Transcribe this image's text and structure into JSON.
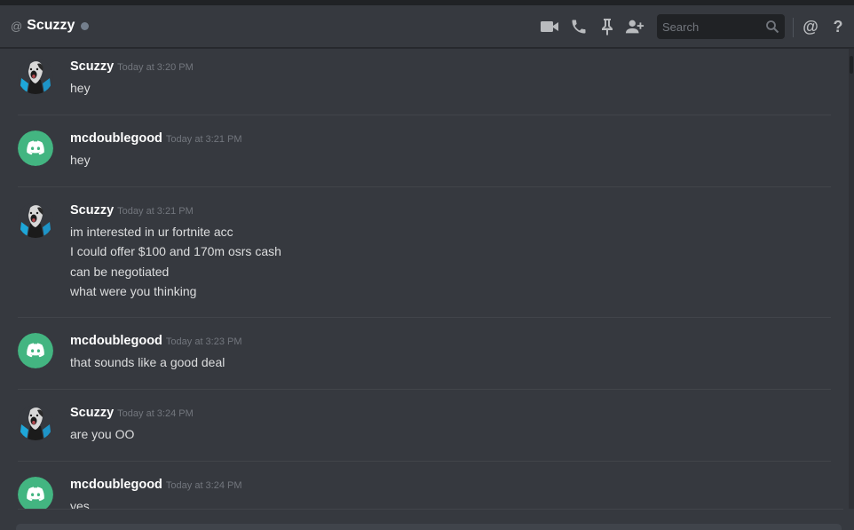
{
  "header": {
    "at_symbol": "@",
    "channel_name": "Scuzzy",
    "search_placeholder": "Search",
    "icons": [
      "video-call-icon",
      "voice-call-icon",
      "pin-icon",
      "add-friend-icon",
      "search-icon",
      "mention-icon",
      "help-icon"
    ],
    "mention_label": "@",
    "help_label": "?"
  },
  "colors": {
    "background": "#36393f",
    "header_bg": "#36393f",
    "search_bg": "#202225",
    "discord_avatar": "#43b581",
    "status_offline": "#747f8d",
    "username": "#ffffff",
    "timestamp": "#72767d",
    "message_text": "#dcddde"
  },
  "messages": [
    {
      "author": "Scuzzy",
      "avatar": "scuzzy-avatar",
      "timestamp": "Today at 3:20 PM",
      "lines": [
        "hey"
      ]
    },
    {
      "author": "mcdoublegood",
      "avatar": "discord-default-avatar",
      "timestamp": "Today at 3:21 PM",
      "lines": [
        "hey"
      ]
    },
    {
      "author": "Scuzzy",
      "avatar": "scuzzy-avatar",
      "timestamp": "Today at 3:21 PM",
      "lines": [
        "im interested in ur fortnite acc",
        "I could offer $100 and 170m osrs cash",
        "can be negotiated",
        "what were you thinking"
      ]
    },
    {
      "author": "mcdoublegood",
      "avatar": "discord-default-avatar",
      "timestamp": "Today at 3:23 PM",
      "lines": [
        "that sounds like a good deal"
      ]
    },
    {
      "author": "Scuzzy",
      "avatar": "scuzzy-avatar",
      "timestamp": "Today at 3:24 PM",
      "lines": [
        "are you OO"
      ]
    },
    {
      "author": "mcdoublegood",
      "avatar": "discord-default-avatar",
      "timestamp": "Today at 3:24 PM",
      "lines": [
        "yes"
      ]
    }
  ]
}
